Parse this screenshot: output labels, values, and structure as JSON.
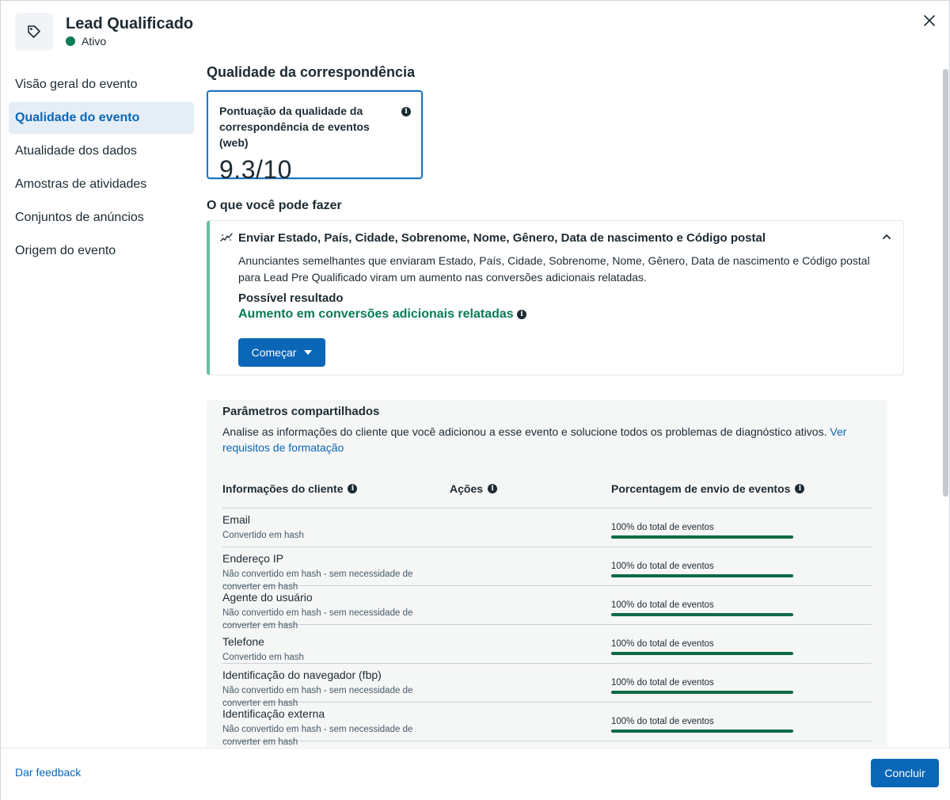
{
  "header": {
    "title": "Lead Qualificado",
    "status": "Ativo",
    "status_color": "#0a7b54",
    "icon": "tag-icon"
  },
  "sidebar": {
    "items": [
      {
        "label": "Visão geral do evento",
        "active": false
      },
      {
        "label": "Qualidade do evento",
        "active": true
      },
      {
        "label": "Atualidade dos dados",
        "active": false
      },
      {
        "label": "Amostras de atividades",
        "active": false
      },
      {
        "label": "Conjuntos de anúncios",
        "active": false
      },
      {
        "label": "Origem do evento",
        "active": false
      }
    ]
  },
  "main": {
    "section_title": "Qualidade da correspondência",
    "score": {
      "label": "Pontuação da qualidade da correspondência de eventos (web)",
      "value": "9.3/10"
    },
    "todo_title": "O que você pode fazer",
    "recommendation": {
      "title": "Enviar Estado, País, Cidade, Sobrenome, Nome, Gênero, Data de nascimento e Código postal",
      "description": "Anunciantes semelhantes que enviaram Estado, País, Cidade, Sobrenome, Nome, Gênero, Data de nascimento e Código postal para Lead Pre Qualificado viram um aumento nas conversões adicionais relatadas.",
      "result_label": "Possível resultado",
      "result_value": "Aumento em conversões adicionais relatadas",
      "button_label": "Começar"
    },
    "params": {
      "title": "Parâmetros compartilhados",
      "description": "Analise as informações do cliente que você adicionou a esse evento e solucione todos os problemas de diagnóstico ativos. ",
      "link": "Ver requisitos de formatação",
      "columns": [
        "Informações do cliente",
        "Ações",
        "Porcentagem de envio de eventos"
      ],
      "rows": [
        {
          "name": "Email",
          "sub": "Convertido em hash",
          "pct_label": "100% do total de eventos",
          "pct": 100
        },
        {
          "name": "Endereço IP",
          "sub": "Não convertido em hash - sem necessidade de converter em hash",
          "pct_label": "100% do total de eventos",
          "pct": 100
        },
        {
          "name": "Agente do usuário",
          "sub": "Não convertido em hash - sem necessidade de converter em hash",
          "pct_label": "100% do total de eventos",
          "pct": 100
        },
        {
          "name": "Telefone",
          "sub": "Convertido em hash",
          "pct_label": "100% do total de eventos",
          "pct": 100
        },
        {
          "name": "Identificação do navegador (fbp)",
          "sub": "Não convertido em hash - sem necessidade de converter em hash",
          "pct_label": "100% do total de eventos",
          "pct": 100
        },
        {
          "name": "Identificação externa",
          "sub": "Não convertido em hash - sem necessidade de converter em hash",
          "pct_label": "100% do total de eventos",
          "pct": 100
        }
      ]
    }
  },
  "footer": {
    "feedback": "Dar feedback",
    "done": "Concluir"
  },
  "colors": {
    "accent": "#0a66b7",
    "success": "#0a7b54"
  }
}
